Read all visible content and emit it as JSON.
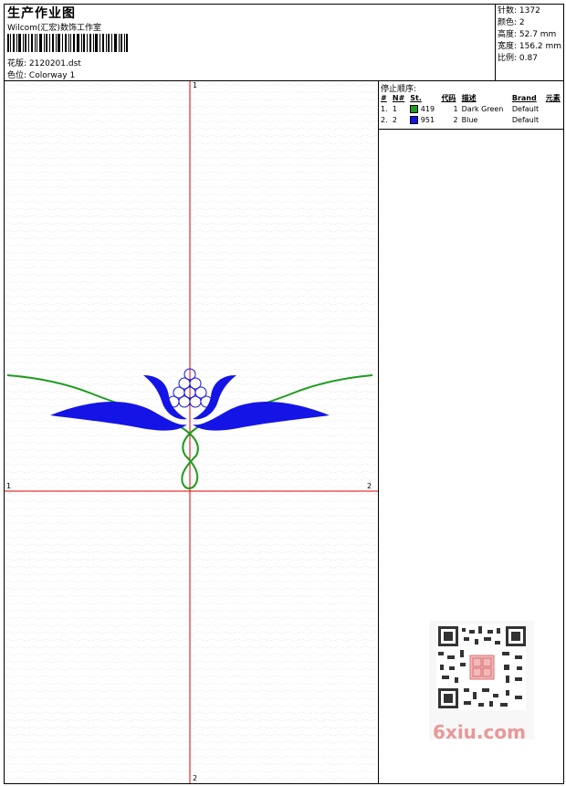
{
  "header": {
    "title": "生产作业图",
    "software": "Wilcom(汇宏)数饰工作室",
    "design_label": "花版:",
    "design_value": "2120201.dst",
    "colorway_label": "色位:",
    "colorway_value": "Colorway 1"
  },
  "stats": {
    "stitches": "针数: 1372",
    "colors": "颜色: 2",
    "height": "高度: 52.7 mm",
    "width": "宽度: 156.2 mm",
    "scale": "比例: 0.87"
  },
  "stop_sequence": {
    "title": "停止顺序:",
    "columns": [
      "#",
      "N#",
      "St.",
      "代码",
      "描述",
      "Brand",
      "元素"
    ],
    "rows": [
      {
        "index": "1.",
        "n": "1",
        "swatch_color": "#1e9b1e",
        "stitches": "419",
        "code": "1",
        "description": "Dark Green",
        "brand": "Default"
      },
      {
        "index": "2.",
        "n": "2",
        "swatch_color": "#1414e6",
        "stitches": "951",
        "code": "2",
        "description": "Blue",
        "brand": "Default"
      }
    ]
  },
  "axes": {
    "top_label": "1",
    "bottom_label": "2",
    "left_label": "1",
    "right_label": "2"
  },
  "colors": {
    "axis": "#e00000",
    "green_thread": "#1e9b1e",
    "blue_thread": "#1414e6"
  },
  "watermark": {
    "site": "6xiu.com"
  }
}
